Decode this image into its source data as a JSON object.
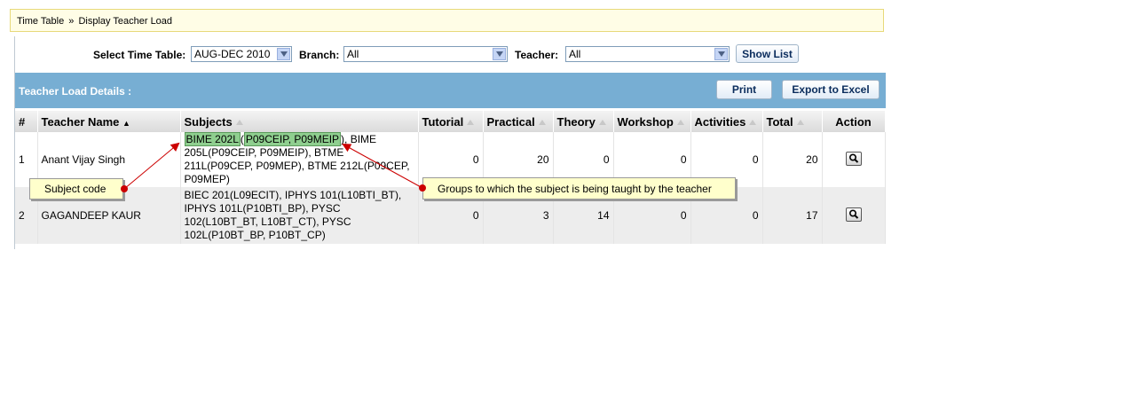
{
  "breadcrumb": {
    "part1": "Time Table",
    "separator": "»",
    "part2": "Display Teacher Load"
  },
  "filters": {
    "timetable_label": "Select Time Table:",
    "timetable_value": "AUG-DEC 2010",
    "branch_label": "Branch:",
    "branch_value": "All",
    "teacher_label": "Teacher:",
    "teacher_value": "All",
    "show_list_label": "Show List"
  },
  "panel": {
    "title": "Teacher Load Details :",
    "print_label": "Print",
    "export_label": "Export to Excel"
  },
  "table": {
    "headers": {
      "num": "#",
      "name": "Teacher Name",
      "subjects": "Subjects",
      "tutorial": "Tutorial",
      "practical": "Practical",
      "theory": "Theory",
      "workshop": "Workshop",
      "activities": "Activities",
      "total": "Total",
      "action": "Action"
    },
    "rows": [
      {
        "num": "1",
        "name": "Anant Vijay Singh",
        "subject_code": "BIME 202L",
        "subject_groups": "P09CEIP, P09MEIP",
        "subjects_rest": ", BIME 205L(P09CEIP, P09MEIP), BTME 211L(P09CEP, P09MEP), BTME 212L(P09CEP, P09MEP)",
        "tutorial": "0",
        "practical": "20",
        "theory": "0",
        "workshop": "0",
        "activities": "0",
        "total": "20"
      },
      {
        "num": "2",
        "name": "GAGANDEEP KAUR",
        "subjects": "BIEC 201(L09ECIT), IPHYS 101(L10BTI_BT), IPHYS 101L(P10BTI_BP), PYSC 102(L10BT_BT, L10BT_CT), PYSC 102L(P10BT_BP, P10BT_CP)",
        "tutorial": "0",
        "practical": "3",
        "theory": "14",
        "workshop": "0",
        "activities": "0",
        "total": "17"
      }
    ]
  },
  "annotations": {
    "subject_code": "Subject code",
    "groups": "Groups to which the subject is being taught by the teacher",
    "arrow_color": "#cc0000"
  }
}
